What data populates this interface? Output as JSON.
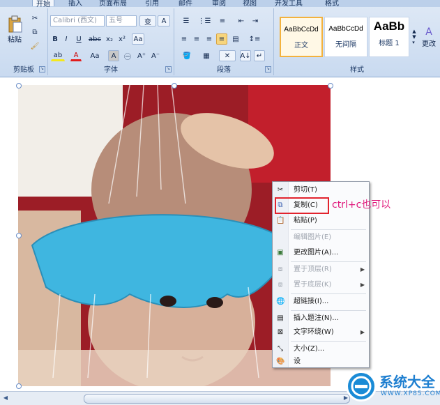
{
  "ribbon": {
    "tabs": [
      "开始",
      "插入",
      "页面布局",
      "引用",
      "邮件",
      "审阅",
      "视图",
      "开发工具",
      "格式"
    ],
    "clipboard": {
      "label": "剪贴板",
      "paste_label": "粘贴"
    },
    "font": {
      "label": "字体",
      "font_name": "Calibri (西文)",
      "font_size": "五号"
    },
    "paragraph": {
      "label": "段落"
    },
    "styles": {
      "label": "样式",
      "change_label": "更改",
      "items": [
        {
          "sample": "AaBbCcDd",
          "name": "正文"
        },
        {
          "sample": "AaBbCcDd",
          "name": "无间隔"
        },
        {
          "sample": "AaBb",
          "name": "标题 1"
        }
      ]
    }
  },
  "context_menu": {
    "items": [
      {
        "label": "剪切(T)",
        "icon": "scissors-icon",
        "enabled": true
      },
      {
        "label": "复制(C)",
        "icon": "copy-icon",
        "enabled": true
      },
      {
        "label": "粘贴(P)",
        "icon": "paste-icon",
        "enabled": true
      },
      {
        "label": "编辑图片(E)",
        "icon": "",
        "enabled": false
      },
      {
        "label": "更改图片(A)...",
        "icon": "change-picture-icon",
        "enabled": true
      },
      {
        "label": "置于顶层(R)",
        "icon": "bring-to-front-icon",
        "enabled": false
      },
      {
        "label": "置于底层(K)",
        "icon": "send-to-back-icon",
        "enabled": false
      },
      {
        "label": "超链接(I)...",
        "icon": "hyperlink-icon",
        "enabled": true
      },
      {
        "label": "插入题注(N)...",
        "icon": "caption-icon",
        "enabled": true
      },
      {
        "label": "文字环绕(W)",
        "icon": "text-wrap-icon",
        "enabled": true
      },
      {
        "label": "大小(Z)...",
        "icon": "size-icon",
        "enabled": true
      },
      {
        "label": "设",
        "icon": "format-icon",
        "enabled": true
      }
    ]
  },
  "annotation": {
    "text": "ctrl+c也可以",
    "color": "#e0187c",
    "highlight_color": "#e2232d"
  },
  "watermark": {
    "name": "系统大全",
    "url": "WWW.XP85.COM"
  },
  "colors": {
    "ribbon_bg": "#dfe9f6",
    "selected_style": "#f3b23e",
    "hat_blue": "#3fb6e0"
  }
}
